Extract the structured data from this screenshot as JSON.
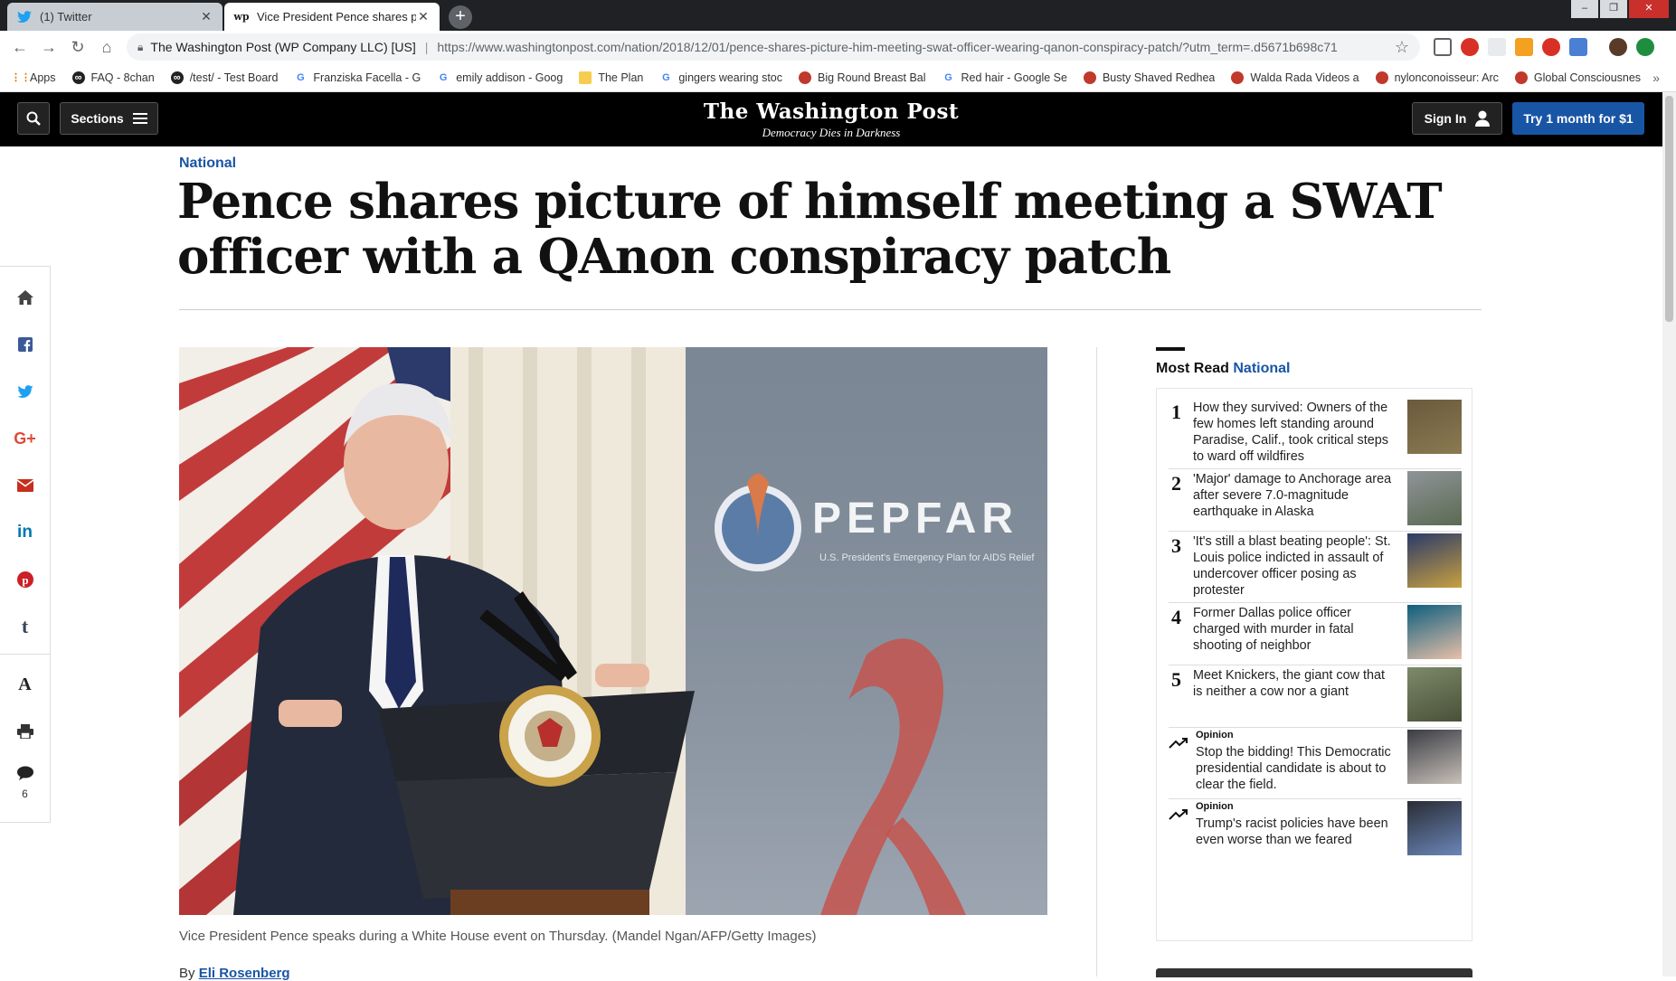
{
  "browser": {
    "tabs": [
      {
        "title": "(1) Twitter",
        "icon": "twitter-icon",
        "active": false
      },
      {
        "title": "Vice President Pence shares phot",
        "icon": "wp-favicon",
        "favicon_text": "wp",
        "active": true
      }
    ],
    "omnibox": {
      "site_name": "The Washington Post (WP Company LLC) [US]",
      "url": "https://www.washingtonpost.com/nation/2018/12/01/pence-shares-picture-him-meeting-swat-officer-wearing-qanon-conspiracy-patch/?utm_term=.d5671b698c71"
    },
    "bookmarks": [
      {
        "label": "Apps",
        "icon": "apps-grid-icon"
      },
      {
        "label": "FAQ - 8chan",
        "icon": "8chan-icon"
      },
      {
        "label": "/test/ - Test Board",
        "icon": "8chan-icon"
      },
      {
        "label": "Franziska Facella - G",
        "icon": "google-icon"
      },
      {
        "label": "emily addison - Goog",
        "icon": "google-icon"
      },
      {
        "label": "The Plan",
        "icon": "folder-icon"
      },
      {
        "label": "gingers wearing stoc",
        "icon": "google-icon"
      },
      {
        "label": "Big Round Breast Bal",
        "icon": "site-icon"
      },
      {
        "label": "Red hair - Google Se",
        "icon": "google-icon"
      },
      {
        "label": "Busty Shaved Redhea",
        "icon": "site-icon"
      },
      {
        "label": "Walda Rada Videos a",
        "icon": "site-icon"
      },
      {
        "label": "nylonconoisseur: Arc",
        "icon": "site-icon"
      },
      {
        "label": "Global Consciousnes",
        "icon": "site-icon"
      }
    ],
    "bookmarks_more": "»"
  },
  "header": {
    "sections_label": "Sections",
    "logo": "The Washington Post",
    "tagline": "Democracy Dies in Darkness",
    "signin_label": "Sign In",
    "subscribe_label": "Try 1 month for $1"
  },
  "share_rail": {
    "items": [
      "home-icon",
      "facebook-icon",
      "twitter-icon",
      "google-plus-icon",
      "email-icon",
      "linkedin-icon",
      "pinterest-icon",
      "tumblr-icon",
      "font-size-icon",
      "print-icon",
      "comments-icon"
    ],
    "google_plus_glyph": "G+",
    "linkedin_glyph": "in",
    "tumblr_glyph": "t",
    "font_glyph": "A",
    "comment_count": "6"
  },
  "article": {
    "kicker": "National",
    "headline": "Pence shares picture of himself meeting a SWAT officer with a QAnon conspiracy patch",
    "photo_sign_text": "PEPFAR",
    "photo_sign_subtext": "U.S. President's Emergency Plan for AIDS Relief",
    "caption": "Vice President Pence speaks during a White House event on Thursday. (Mandel Ngan/AFP/Getty Images)",
    "byline_prefix": "By",
    "author": "Eli Rosenberg"
  },
  "most_read": {
    "title": "Most Read",
    "section": "National",
    "items": [
      {
        "rank": "1",
        "text": "How they survived: Owners of the few homes left standing around Paradise, Calif., took critical steps to ward off wildfires"
      },
      {
        "rank": "2",
        "text": "'Major' damage to Anchorage area after severe 7.0-magnitude earthquake in Alaska"
      },
      {
        "rank": "3",
        "text": "'It's still a blast beating people': St. Louis police indicted in assault of undercover officer posing as protester"
      },
      {
        "rank": "4",
        "text": "Former Dallas police officer charged with murder in fatal shooting of neighbor"
      },
      {
        "rank": "5",
        "text": "Meet Knickers, the giant cow that is neither a cow nor a giant"
      },
      {
        "label": "Opinion",
        "text": "Stop the bidding! This Democratic presidential candidate is about to clear the field."
      },
      {
        "label": "Opinion",
        "text": "Trump's racist policies have been even worse than we feared"
      }
    ]
  },
  "colors": {
    "wapo_blue": "#1955a5",
    "header_bg": "#000000",
    "chrome_dark": "#202124"
  }
}
